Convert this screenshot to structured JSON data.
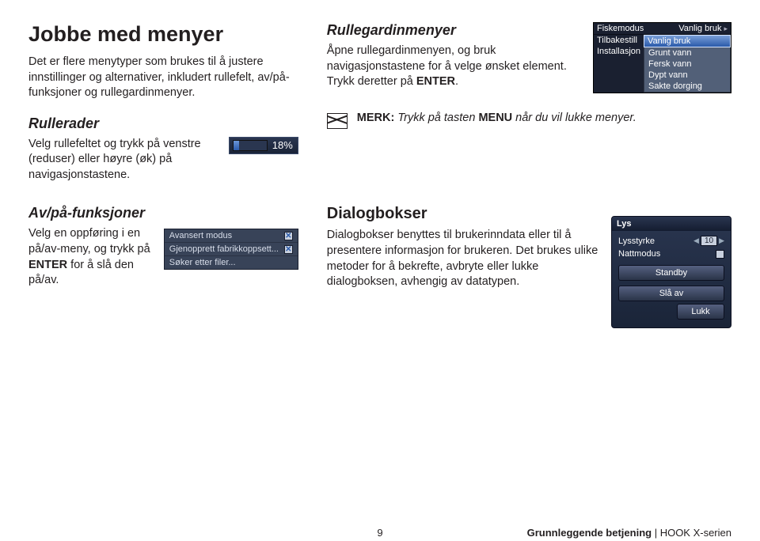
{
  "title": "Jobbe med menyer",
  "intro": "Det er flere menytyper som brukes til å justere innstillinger og alternativer, inkludert rullefelt, av/på-funksjoner og rullegardinmenyer.",
  "rullerader": {
    "heading": "Rullerader",
    "body": "Velg rullefeltet og trykk på venstre (reduser) eller høyre (øk) på navigasjonstastene.",
    "slider_value": "18%"
  },
  "avpa": {
    "heading": "Av/på-funksjoner",
    "body_pre": "Velg en oppføring i en på/av-meny, og trykk på ",
    "body_bold": "ENTER",
    "body_post": " for å slå den på/av."
  },
  "advpanel": {
    "rows": [
      {
        "label": "Avansert modus",
        "checked": true
      },
      {
        "label": "Gjenopprett fabrikkoppsett...",
        "checked": true
      },
      {
        "label": "Søker etter filer...",
        "checked": null
      }
    ]
  },
  "rullegardin": {
    "heading": "Rullegardinmenyer",
    "body_pre": "Åpne rullegardinmenyen, og bruk navigasjonstastene for å velge ønsket element. Trykk deretter på ",
    "body_bold": "ENTER",
    "body_post": "."
  },
  "dropdown": {
    "rows": [
      {
        "l": "Fiskemodus",
        "r": "Vanlig bruk",
        "arrow": "▸"
      },
      {
        "l": "Tilbakestill"
      }
    ],
    "selected": "Vanlig bruk",
    "installasjon": "Installasjon",
    "options": [
      "Grunt vann",
      "Fersk vann",
      "Dypt vann",
      "Sakte dorging"
    ]
  },
  "note": {
    "pre": "MERK:",
    "mid": " Trykk på tasten ",
    "bold": "MENU",
    "post": " når du vil lukke menyer."
  },
  "dialogbokser": {
    "heading": "Dialogbokser",
    "body": "Dialogbokser benyttes til brukerinndata eller til å presentere informasjon for brukeren. Det brukes ulike metoder for å bekrefte, avbryte eller lukke dialogboksen, avhengig av datatypen."
  },
  "dialog": {
    "title": "Lys",
    "brightness_label": "Lysstyrke",
    "brightness_value": "10",
    "nightmode_label": "Nattmodus",
    "btn_standby": "Standby",
    "btn_off": "Slå av",
    "btn_close": "Lukk"
  },
  "footer": {
    "page": "9",
    "crumb_main": "Grunnleggende betjening",
    "crumb_sep": " | ",
    "crumb_sub": "HOOK X-serien"
  }
}
